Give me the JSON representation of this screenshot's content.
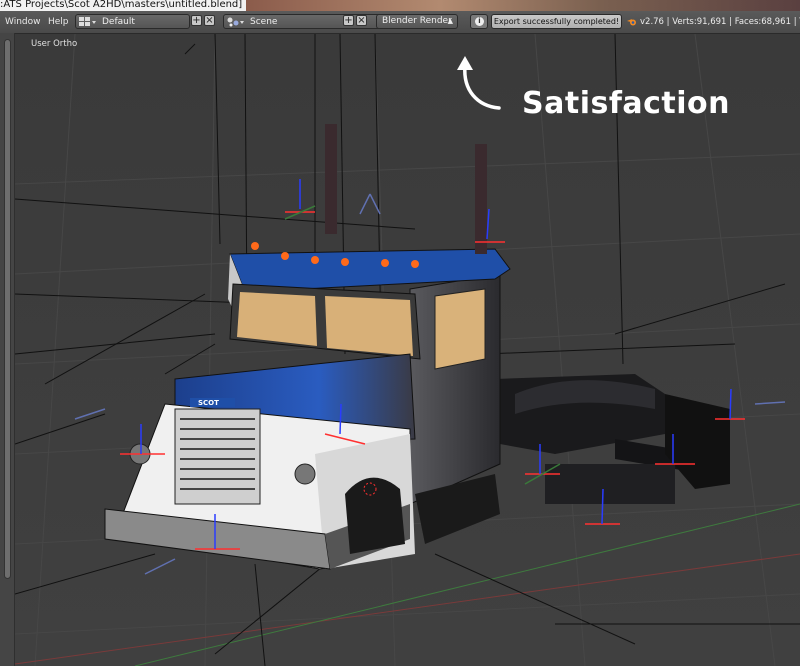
{
  "window": {
    "title": ":ATS Projects\\Scot A2HD\\masters\\untitled.blend]"
  },
  "header": {
    "menus": [
      "Window",
      "Help"
    ],
    "layout": {
      "value": "Default"
    },
    "scene": {
      "value": "Scene"
    },
    "render_engine": {
      "value": "Blender Render"
    },
    "report": {
      "message": "Export successfully completed!"
    },
    "stats": "v2.76 | Verts:91,691 | Faces:68,961 | Tr"
  },
  "viewport": {
    "view_label": "User Ortho",
    "model_badge": "SCOT"
  },
  "annotation": {
    "text": "Satisfaction",
    "color": "#ffffff"
  },
  "colors": {
    "cab_blue": "#1f4fa8",
    "hood_white": "#f0f0f0",
    "background": "#3c3c3c",
    "axis_x": "#ff3030",
    "axis_z": "#2a3cff"
  }
}
